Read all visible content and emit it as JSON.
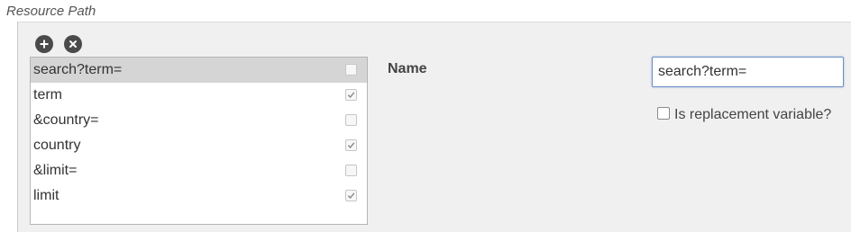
{
  "section_title": "Resource Path",
  "toolbar": {
    "add_icon": "plus-circle-icon",
    "remove_icon": "x-circle-icon"
  },
  "path_list": {
    "items": [
      {
        "label": "search?term=",
        "checked": false,
        "selected": true
      },
      {
        "label": "term",
        "checked": true,
        "selected": false
      },
      {
        "label": "&country=",
        "checked": false,
        "selected": false
      },
      {
        "label": "country",
        "checked": true,
        "selected": false
      },
      {
        "label": "&limit=",
        "checked": false,
        "selected": false
      },
      {
        "label": "limit",
        "checked": true,
        "selected": false
      }
    ]
  },
  "detail": {
    "name_label": "Name",
    "name_value": "search?term=",
    "replacement_label": "Is replacement variable?",
    "replacement_checked": false
  },
  "colors": {
    "selected_row": "#d5d5d5",
    "panel_bg": "#f0f0f0",
    "input_focus_border": "#6c8fc7"
  }
}
